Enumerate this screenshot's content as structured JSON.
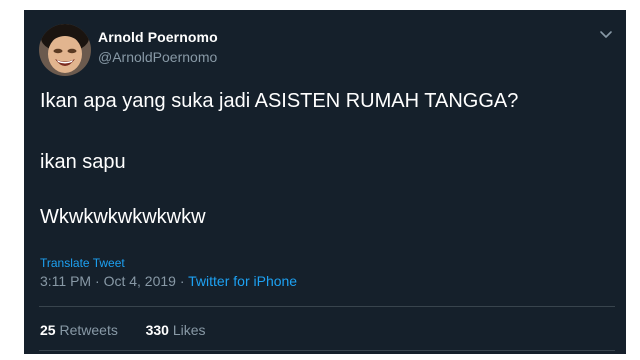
{
  "author": {
    "name": "Arnold Poernomo",
    "handle": "@ArnoldPoernomo"
  },
  "tweet": {
    "lines": [
      "Ikan apa yang suka jadi ASISTEN RUMAH TANGGA?",
      "ikan sapu",
      "Wkwkwkwkwkwkw"
    ],
    "translate_label": "Translate Tweet",
    "time": "3:11 PM",
    "separator": "·",
    "date": "Oct 4, 2019",
    "source": "Twitter for iPhone"
  },
  "stats": {
    "retweets_count": "25",
    "retweets_label": "Retweets",
    "likes_count": "330",
    "likes_label": "Likes"
  },
  "colors": {
    "background": "#15202b",
    "accent": "#1da1f2",
    "muted": "#8899a6",
    "divider": "#38444d"
  },
  "icons": {
    "menu": "chevron-down-icon"
  }
}
